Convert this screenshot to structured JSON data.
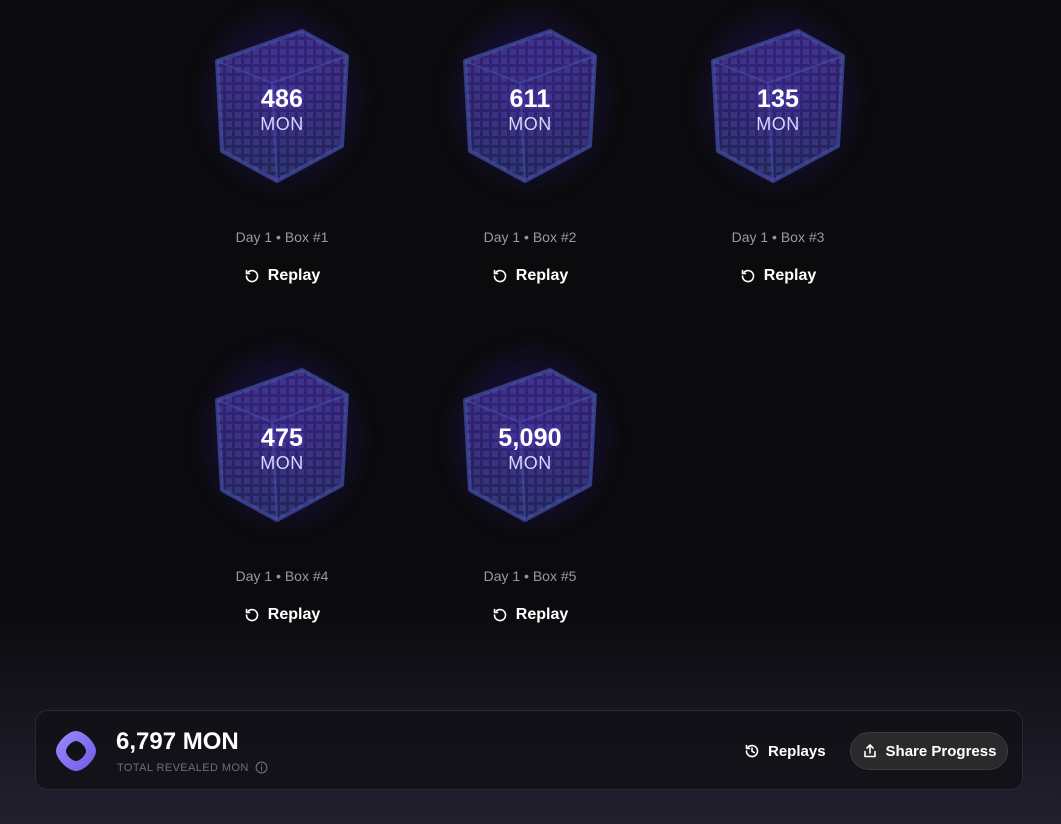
{
  "boxes": [
    {
      "value": "486",
      "unit": "MON",
      "caption": "Day 1 • Box #1",
      "replay_label": "Replay"
    },
    {
      "value": "611",
      "unit": "MON",
      "caption": "Day 1 • Box #2",
      "replay_label": "Replay"
    },
    {
      "value": "135",
      "unit": "MON",
      "caption": "Day 1 • Box #3",
      "replay_label": "Replay"
    },
    {
      "value": "475",
      "unit": "MON",
      "caption": "Day 1 • Box #4",
      "replay_label": "Replay"
    },
    {
      "value": "5,090",
      "unit": "MON",
      "caption": "Day 1 • Box #5",
      "replay_label": "Replay"
    }
  ],
  "footer": {
    "total_value": "6,797 MON",
    "total_label": "TOTAL REVEALED MON",
    "replays_label": "Replays",
    "share_label": "Share Progress",
    "logo_icon": "monad-logo-icon",
    "info_icon": "info-icon",
    "replays_icon": "history-icon",
    "share_icon": "share-icon"
  },
  "colors": {
    "accent": "#7b6cf6",
    "background": "#0b0b0d",
    "cube_glow": "#4628c8",
    "muted_text": "#9a98a6"
  }
}
